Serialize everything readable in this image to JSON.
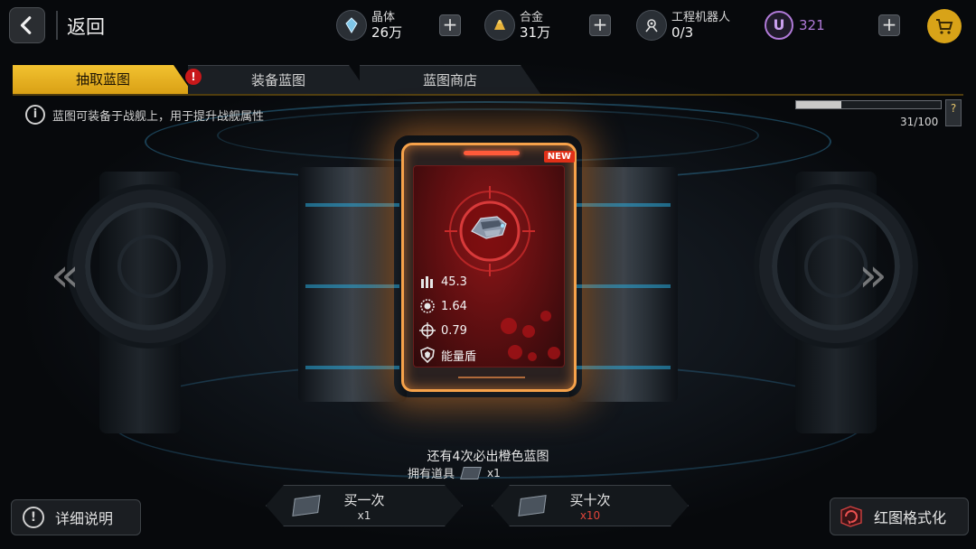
{
  "topbar": {
    "back_label": "返回",
    "crystal": {
      "name": "晶体",
      "value": "26万",
      "icon": "crystal-icon"
    },
    "alloy": {
      "name": "合金",
      "value": "31万",
      "icon": "alloy-icon"
    },
    "robot": {
      "name": "工程机器人",
      "value": "0/3",
      "icon": "robot-icon"
    },
    "plus": "+",
    "ucoin": {
      "symbol": "U",
      "value": "321",
      "color": "#b07ad8"
    }
  },
  "tabs": [
    {
      "label": "抽取蓝图",
      "active": true
    },
    {
      "label": "装备蓝图",
      "alert": "!"
    },
    {
      "label": "蓝图商店"
    }
  ],
  "info": {
    "icon_text": "i",
    "text": "蓝图可装备于战舰上，用于提升战舰属性",
    "progress_text": "31/100",
    "progress_fraction": 0.31,
    "help": "?"
  },
  "arrows": {
    "left": "«",
    "right": "»"
  },
  "card": {
    "badge": "NEW",
    "stats": [
      {
        "icon": "ammo-icon",
        "value": "45.3"
      },
      {
        "icon": "gear-icon",
        "value": "1.64"
      },
      {
        "icon": "crosshair-icon",
        "value": "0.79"
      },
      {
        "icon": "shield-icon",
        "value": "能量盾"
      }
    ],
    "accent": "#f6a24a"
  },
  "bottom": {
    "pity_text": "还有4次必出橙色蓝图",
    "owned_label": "拥有道具",
    "owned_count": "x1",
    "detail_icon": "!",
    "detail_label": "详细说明",
    "buy_one": {
      "label": "买一次",
      "qty": "x1"
    },
    "buy_ten": {
      "label": "买十次",
      "qty": "x10",
      "qty_color": "#e0443a"
    },
    "format_label": "红图格式化"
  }
}
